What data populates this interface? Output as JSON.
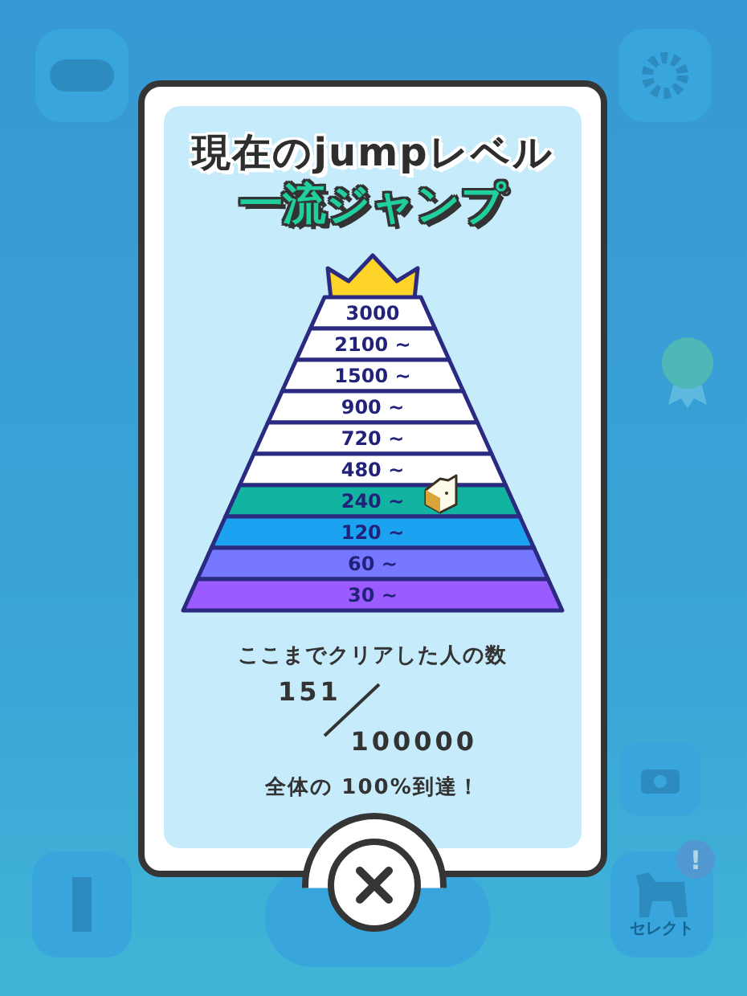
{
  "title": "現在のjumpレベル",
  "level_name": "一流ジャンプ",
  "tiers": [
    {
      "label": "3000",
      "color": "#ffffff",
      "selected": false
    },
    {
      "label": "2100 ~",
      "color": "#ffffff",
      "selected": false
    },
    {
      "label": "1500 ~",
      "color": "#ffffff",
      "selected": false
    },
    {
      "label": "900 ~",
      "color": "#ffffff",
      "selected": false
    },
    {
      "label": "720 ~",
      "color": "#ffffff",
      "selected": false
    },
    {
      "label": "480 ~",
      "color": "#ffffff",
      "selected": false
    },
    {
      "label": "240 ~",
      "color": "#12b3a0",
      "selected": true
    },
    {
      "label": "120 ~",
      "color": "#1ba3f2",
      "selected": false
    },
    {
      "label": "60 ~",
      "color": "#7679ff",
      "selected": false
    },
    {
      "label": "30 ~",
      "color": "#9b5cff",
      "selected": false
    }
  ],
  "cleared": {
    "caption": "ここまでクリアした人の数",
    "count": "151",
    "total": "100000",
    "summary": "全体の 100%到達！"
  },
  "background": {
    "select_label": "セレクト",
    "badge": "!"
  }
}
